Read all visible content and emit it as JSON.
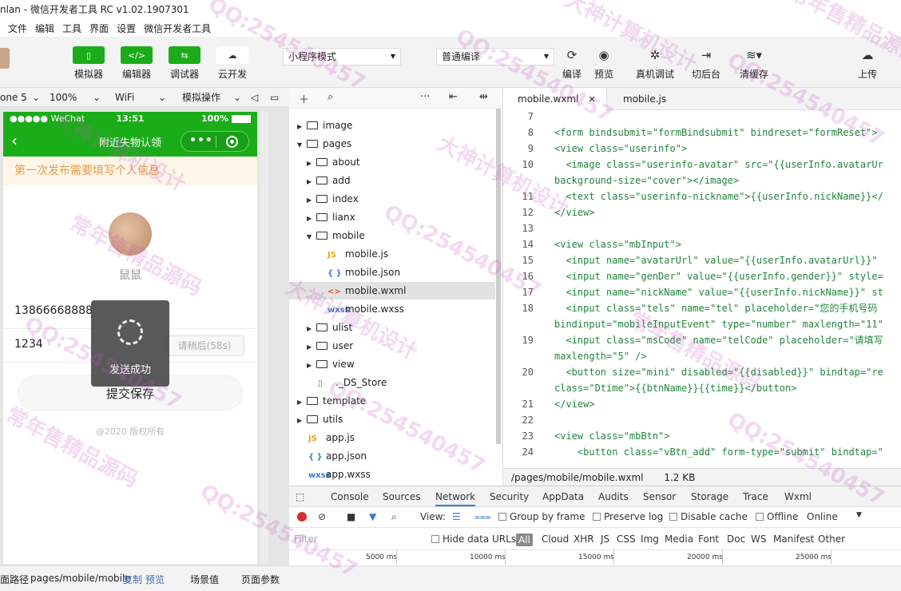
{
  "window": {
    "title": "nlan - 微信开发者工具 RC v1.02.1907301"
  },
  "menu": [
    "文件",
    "编辑",
    "工具",
    "界面",
    "设置",
    "微信开发者工具"
  ],
  "toolbar": {
    "simulator": "模拟器",
    "editor": "编辑器",
    "debugger": "调试器",
    "cloud": "云开发",
    "mode_select": "小程序模式",
    "compile_select": "普通编译",
    "compile": "编译",
    "preview": "预览",
    "remote_debug": "真机调试",
    "background": "切后台",
    "clear_cache": "清缓存",
    "upload": "上传"
  },
  "devicebar": {
    "device": "one 5",
    "zoom": "100%",
    "network": "WiFi",
    "simulate": "模拟操作"
  },
  "phone": {
    "carrier": "●●●●● WeChat",
    "time": "13:51",
    "battery": "100%",
    "nav_title": "附近失物认领",
    "notice": "第一次发布需要填写个人信息",
    "nickname": "鼠鼠",
    "phone_value": "13866668888",
    "code_value": "1234",
    "code_button": "请稍后(58s)",
    "save_button": "提交保存",
    "copyright": "@2020 版权所有",
    "toast": "发送成功"
  },
  "filetree": {
    "items": [
      {
        "name": "image",
        "depth": 0,
        "type": "folder",
        "expanded": false
      },
      {
        "name": "pages",
        "depth": 0,
        "type": "folder",
        "expanded": true
      },
      {
        "name": "about",
        "depth": 1,
        "type": "folder",
        "expanded": false
      },
      {
        "name": "add",
        "depth": 1,
        "type": "folder",
        "expanded": false
      },
      {
        "name": "index",
        "depth": 1,
        "type": "folder",
        "expanded": false
      },
      {
        "name": "lianx",
        "depth": 1,
        "type": "folder",
        "expanded": false
      },
      {
        "name": "mobile",
        "depth": 1,
        "type": "folder",
        "expanded": true
      },
      {
        "name": "mobile.js",
        "depth": 2,
        "type": "js"
      },
      {
        "name": "mobile.json",
        "depth": 2,
        "type": "json"
      },
      {
        "name": "mobile.wxml",
        "depth": 2,
        "type": "wxml",
        "selected": true
      },
      {
        "name": "mobile.wxss",
        "depth": 2,
        "type": "wxss"
      },
      {
        "name": "ulist",
        "depth": 1,
        "type": "folder",
        "expanded": false
      },
      {
        "name": "user",
        "depth": 1,
        "type": "folder",
        "expanded": false
      },
      {
        "name": "view",
        "depth": 1,
        "type": "folder",
        "expanded": false
      },
      {
        "name": "._DS_Store",
        "depth": 1,
        "type": "file"
      },
      {
        "name": "template",
        "depth": 0,
        "type": "folder",
        "expanded": false
      },
      {
        "name": "utils",
        "depth": 0,
        "type": "folder",
        "expanded": false
      },
      {
        "name": "app.js",
        "depth": 0,
        "type": "js"
      },
      {
        "name": "app.json",
        "depth": 0,
        "type": "json"
      },
      {
        "name": "app.wxss",
        "depth": 0,
        "type": "wxss"
      }
    ]
  },
  "editor": {
    "tabs": [
      "mobile.wxml",
      "mobile.js"
    ],
    "lines": [
      {
        "n": "7",
        "text": ""
      },
      {
        "n": "8",
        "text": "<form bindsubmit=\"formBindsubmit\" bindreset=\"formReset\">"
      },
      {
        "n": "9",
        "text": "<view class=\"userinfo\">"
      },
      {
        "n": "10",
        "text": "  <image class=\"userinfo-avatar\" src=\"{{userInfo.avatarUr"
      },
      {
        "n": "",
        "text": "background-size=\"cover\"></image>"
      },
      {
        "n": "11",
        "text": "  <text class=\"userinfo-nickname\">{{userInfo.nickName}}</"
      },
      {
        "n": "12",
        "text": "</view>"
      },
      {
        "n": "13",
        "text": ""
      },
      {
        "n": "14",
        "text": "<view class=\"mbInput\">"
      },
      {
        "n": "15",
        "text": "  <input name=\"avatarUrl\" value=\"{{userInfo.avatarUrl}}\""
      },
      {
        "n": "16",
        "text": "  <input name=\"genDer\" value=\"{{userInfo.gender}}\" style="
      },
      {
        "n": "17",
        "text": "  <input name=\"nickName\" value=\"{{userInfo.nickName}}\" st"
      },
      {
        "n": "18",
        "text": "  <input class=\"tels\" name=\"tel\" placeholder=\"您的手机号码"
      },
      {
        "n": "",
        "text": "bindinput=\"mobileInputEvent\" type=\"number\" maxlength=\"11\""
      },
      {
        "n": "19",
        "text": "  <input class=\"msCode\" name=\"telCode\" placeholder=\"请填写"
      },
      {
        "n": "",
        "text": "maxlength=\"5\" />"
      },
      {
        "n": "20",
        "text": "  <button size=\"mini\" disabled=\"{{disabled}}\" bindtap=\"re"
      },
      {
        "n": "",
        "text": "class=\"Dtime\">{{btnName}}{{time}}</button>"
      },
      {
        "n": "21",
        "text": "</view>"
      },
      {
        "n": "22",
        "text": ""
      },
      {
        "n": "23",
        "text": "<view class=\"mbBtn\">"
      },
      {
        "n": "24",
        "text": "    <button class=\"vBtn_add\" form-type=\"submit\" bindtap=\""
      }
    ],
    "file_path": "/pages/mobile/mobile.wxml",
    "file_size": "1.2 KB"
  },
  "devtools": {
    "tabs": [
      "Console",
      "Sources",
      "Network",
      "Security",
      "AppData",
      "Audits",
      "Sensor",
      "Storage",
      "Trace",
      "Wxml"
    ],
    "active_tab": "Network",
    "view_label": "View:",
    "group_by_frame": "Group by frame",
    "preserve_log": "Preserve log",
    "disable_cache": "Disable cache",
    "offline": "Offline",
    "online": "Online",
    "filter_placeholder": "Filter",
    "hide_data_urls": "Hide data URLs",
    "filter_types": [
      "All",
      "Cloud",
      "XHR",
      "JS",
      "CSS",
      "Img",
      "Media",
      "Font",
      "Doc",
      "WS",
      "Manifest",
      "Other"
    ],
    "timeline": [
      "5000 ms",
      "10000 ms",
      "15000 ms",
      "20000 ms",
      "25000 ms"
    ]
  },
  "statusbar": {
    "path_label": "面路径",
    "page_path": "pages/mobile/mobile",
    "copy": "复制",
    "preview": "预览",
    "scene": "场景值",
    "page_params": "页面参数"
  },
  "watermark": {
    "qq": "QQ:254540457",
    "a": "常年售精品源码",
    "b": "大神计算机设计"
  }
}
